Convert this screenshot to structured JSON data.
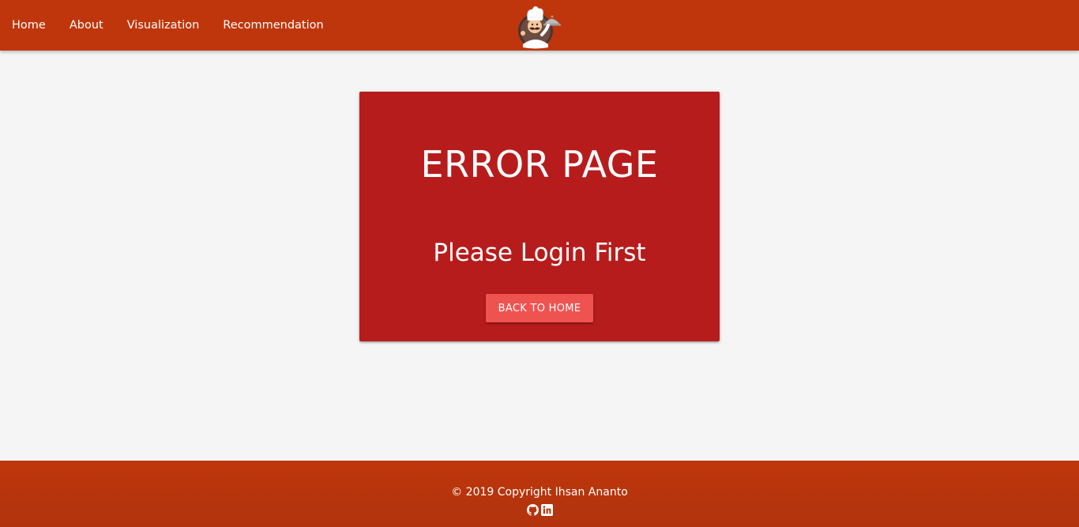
{
  "nav": {
    "links": [
      {
        "label": "Home"
      },
      {
        "label": "About"
      },
      {
        "label": "Visualization"
      },
      {
        "label": "Recommendation"
      }
    ],
    "logo_icon": "chef-mascot-logo"
  },
  "error_card": {
    "title": "ERROR PAGE",
    "message": "Please Login First",
    "button_label": "BACK TO HOME"
  },
  "footer": {
    "copyright": "© 2019 Copyright Ihsan Ananto",
    "icons": [
      "github-icon",
      "linkedin-icon"
    ]
  },
  "colors": {
    "navbar": "#bf360c",
    "background": "#f5f5f5",
    "card": "#b71c1c",
    "button": "#ef5350",
    "text": "#ffffff"
  }
}
